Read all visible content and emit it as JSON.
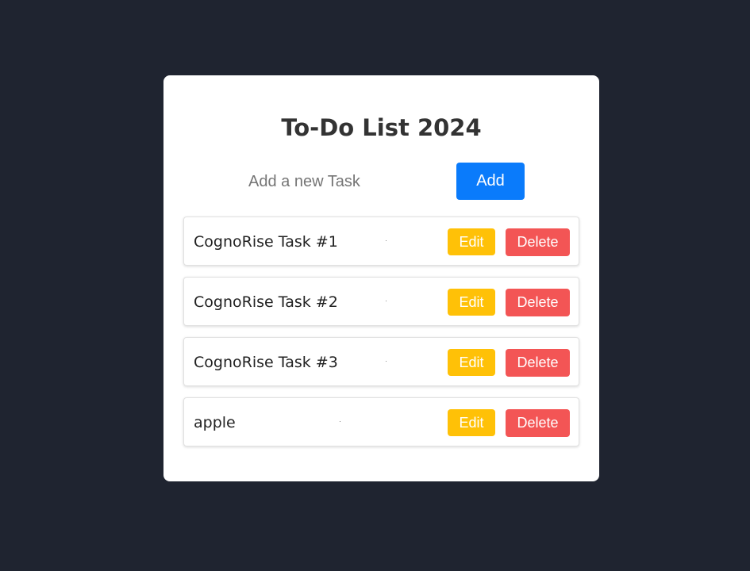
{
  "app": {
    "title": "To-Do List 2024"
  },
  "input": {
    "placeholder": "Add a new Task",
    "value": ""
  },
  "add_button": {
    "label": "Add"
  },
  "tasks": [
    {
      "text": "CognoRise Task #1",
      "edit_label": "Edit",
      "delete_label": "Delete"
    },
    {
      "text": "CognoRise Task #2",
      "edit_label": "Edit",
      "delete_label": "Delete"
    },
    {
      "text": "CognoRise Task #3",
      "edit_label": "Edit",
      "delete_label": "Delete"
    },
    {
      "text": "apple",
      "edit_label": "Edit",
      "delete_label": "Delete"
    }
  ],
  "colors": {
    "background": "#1f2430",
    "card": "#ffffff",
    "add_button": "#0a7bfb",
    "edit_button": "#ffc107",
    "delete_button": "#f35555"
  }
}
